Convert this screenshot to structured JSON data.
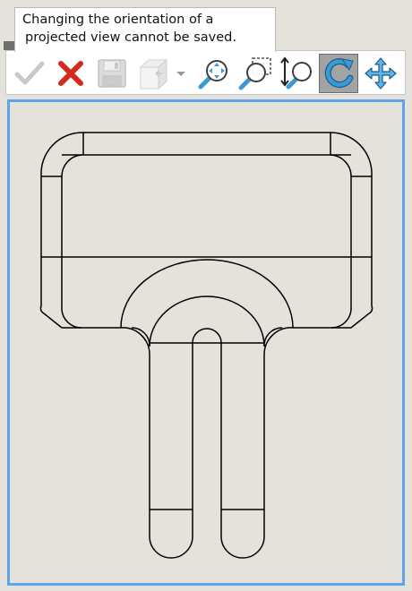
{
  "tooltip": {
    "line1": "Changing the orientation of a",
    "line2": "projected view cannot be saved."
  },
  "toolbar": {
    "tools": [
      {
        "name": "ok",
        "icon": "checkmark-icon",
        "enabled": false
      },
      {
        "name": "cancel",
        "icon": "close-icon",
        "enabled": true,
        "color": "#d42a1c"
      },
      {
        "name": "save",
        "icon": "save-icon",
        "enabled": false
      },
      {
        "name": "view-orientation",
        "icon": "cube-view-icon",
        "enabled": false,
        "has_dropdown": true
      },
      {
        "name": "zoom-to-fit",
        "icon": "zoom-fit-icon",
        "enabled": true
      },
      {
        "name": "zoom-to-area",
        "icon": "zoom-area-icon",
        "enabled": true
      },
      {
        "name": "zoom-in-out",
        "icon": "zoom-in-out-icon",
        "enabled": true
      },
      {
        "name": "rotate",
        "icon": "rotate-icon",
        "enabled": true,
        "active": true
      },
      {
        "name": "pan",
        "icon": "pan-icon",
        "enabled": true
      }
    ]
  },
  "colors": {
    "viewport_border": "#5ea4ea",
    "background": "#e4e2da",
    "icon_blue": "#3a9ad6",
    "active_tool": "#a3a3a3"
  }
}
